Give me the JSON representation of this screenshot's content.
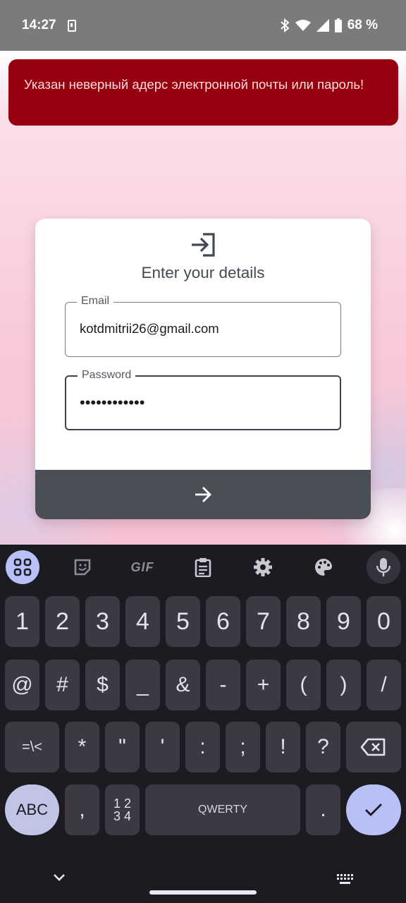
{
  "status_bar": {
    "time": "14:27",
    "battery": "68 %",
    "icons": [
      "download-icon",
      "bluetooth-icon",
      "wifi-icon",
      "signal-icon",
      "battery-icon"
    ]
  },
  "error_banner": {
    "text": "Указан неверный адерс электронной почты или пароль!",
    "color": "#97000f"
  },
  "login_card": {
    "icon": "login-icon",
    "title": "Enter your details",
    "email": {
      "label": "Email",
      "value": "kotdmitrii26@gmail.com"
    },
    "password": {
      "label": "Password",
      "value": "••••••••••••"
    },
    "submit_icon": "arrow-right-icon"
  },
  "keyboard": {
    "toolbar": [
      "apps-grid-icon",
      "sticker-icon",
      "GIF",
      "clipboard-icon",
      "gear-icon",
      "palette-icon",
      "mic-icon"
    ],
    "gif_label": "GIF",
    "row1": [
      "1",
      "2",
      "3",
      "4",
      "5",
      "6",
      "7",
      "8",
      "9",
      "0"
    ],
    "row2": [
      "@",
      "#",
      "$",
      "_",
      "&",
      "-",
      "+",
      "(",
      ")",
      "/"
    ],
    "row3": [
      "=\\<",
      "*",
      "\"",
      "'",
      ":",
      ";",
      "!",
      "?"
    ],
    "row4": {
      "abc": "ABC",
      "comma": ",",
      "numpad_top": "1 2",
      "numpad_bottom": "3 4",
      "space": "QWERTY",
      "period": "."
    },
    "accent": "#b7c1f5"
  }
}
